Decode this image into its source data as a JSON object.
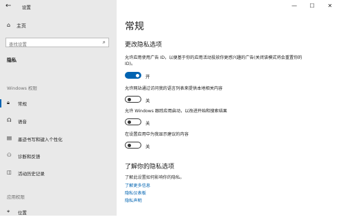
{
  "window": {
    "back_glyph": "←",
    "title": "设置",
    "controls": [
      "—",
      "☐",
      "✕"
    ]
  },
  "sidebar": {
    "home_label": "主页",
    "search_placeholder": "查找设置",
    "section_title": "隐私",
    "group1_label": "Windows 权限",
    "items": [
      {
        "label": "常规",
        "icon": "lock-icon",
        "active": true
      },
      {
        "label": "语音",
        "icon": "speech-icon"
      },
      {
        "label": "墨迹书写和键入个性化",
        "icon": "ink-icon"
      },
      {
        "label": "诊断和反馈",
        "icon": "feedback-icon"
      },
      {
        "label": "活动历史记录",
        "icon": "history-icon"
      }
    ],
    "group2_label": "应用权限",
    "app_items": [
      {
        "label": "位置",
        "icon": "location-icon"
      }
    ]
  },
  "main": {
    "title": "常规",
    "section_title": "更改隐私选项",
    "options": [
      {
        "desc": "允许应用使用广告 ID，以便基于你的应用活动投放你更感兴趣的广告(关闭该模式将会重置你的 ID)。",
        "state": "开",
        "on": true
      },
      {
        "desc": "允许网站通过访问我的语言列表来提供本地相关内容",
        "state": "关",
        "on": false
      },
      {
        "desc": "允许 Windows 跟踪应用启动，以改进开始和搜索结果",
        "state": "关",
        "on": false
      },
      {
        "desc": "在设置应用中为我显示建议的内容",
        "state": "关",
        "on": false
      }
    ],
    "learn_title": "了解你的隐私选项",
    "learn_text": "了解此设置如何影响你的隐私。",
    "links": [
      "了解更多信息",
      "隐私仪表板",
      "隐私声明"
    ]
  },
  "colors": {
    "accent": "#0063b1",
    "sidebar_bg": "#e9e9e9"
  }
}
